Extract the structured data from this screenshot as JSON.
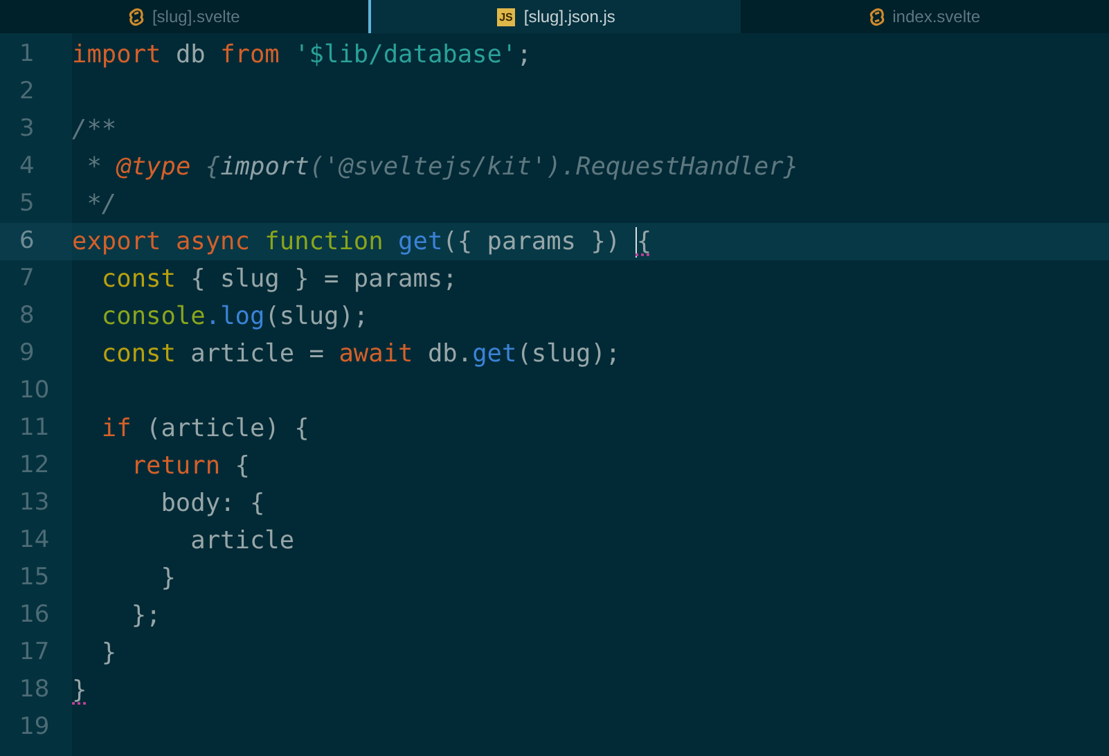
{
  "tabs": [
    {
      "label": "[slug].svelte",
      "kind": "svelte",
      "selected": false
    },
    {
      "label": "[slug].json.js",
      "kind": "js",
      "icon_text": "JS",
      "selected": true
    },
    {
      "label": "index.svelte",
      "kind": "svelte",
      "selected": false
    }
  ],
  "lines": [
    {
      "number": "1",
      "current": false,
      "tokens": [
        {
          "kind": "keyword",
          "text": "import"
        },
        {
          "kind": "plain",
          "text": " db "
        },
        {
          "kind": "keyword",
          "text": "from"
        },
        {
          "kind": "string",
          "text": " '$lib/database'"
        },
        {
          "kind": "plain",
          "text": ";"
        }
      ]
    },
    {
      "number": "2",
      "current": false
    },
    {
      "number": "3",
      "current": false,
      "tokens": [
        {
          "kind": "comment",
          "text": "/**"
        }
      ]
    },
    {
      "number": "4",
      "current": false,
      "tokens": [
        {
          "kind": "comment",
          "text": " * "
        },
        {
          "kind": "doc_tag",
          "text": "@type"
        },
        {
          "kind": "comment",
          "text": " {"
        },
        {
          "kind": "doc_type",
          "text": "import"
        },
        {
          "kind": "comment",
          "text": "('@sveltejs/kit').RequestHandler}"
        }
      ]
    },
    {
      "number": "5",
      "current": false,
      "tokens": [
        {
          "kind": "comment",
          "text": " */"
        }
      ]
    },
    {
      "number": "6",
      "current": true,
      "tokens": [
        {
          "kind": "keyword",
          "text": "export"
        },
        {
          "kind": "keyword",
          "text": " async"
        },
        {
          "kind": "storage",
          "text": " function"
        },
        {
          "kind": "call",
          "text": " get"
        },
        {
          "kind": "plain",
          "text": "({ params }) "
        },
        {
          "kind": "cursor"
        },
        {
          "kind": "plain",
          "text": "{",
          "flagged": true
        }
      ]
    },
    {
      "number": "7",
      "current": false,
      "tokens": [
        {
          "kind": "declare",
          "text": "  const"
        },
        {
          "kind": "plain",
          "text": " { slug } = params;"
        }
      ]
    },
    {
      "number": "8",
      "current": false,
      "tokens": [
        {
          "kind": "storage",
          "text": "  console"
        },
        {
          "kind": "call",
          "text": ".log"
        },
        {
          "kind": "plain",
          "text": "(slug);"
        }
      ]
    },
    {
      "number": "9",
      "current": false,
      "tokens": [
        {
          "kind": "declare",
          "text": "  const"
        },
        {
          "kind": "plain",
          "text": " article = "
        },
        {
          "kind": "keyword",
          "text": "await"
        },
        {
          "kind": "plain",
          "text": " db."
        },
        {
          "kind": "call",
          "text": "get"
        },
        {
          "kind": "plain",
          "text": "(slug);"
        }
      ]
    },
    {
      "number": "10",
      "current": false
    },
    {
      "number": "11",
      "current": false,
      "tokens": [
        {
          "kind": "keyword",
          "text": "  if"
        },
        {
          "kind": "plain",
          "text": " (article) {"
        }
      ]
    },
    {
      "number": "12",
      "current": false,
      "tokens": [
        {
          "kind": "keyword",
          "text": "    return"
        },
        {
          "kind": "plain",
          "text": " {"
        }
      ]
    },
    {
      "number": "13",
      "current": false,
      "tokens": [
        {
          "kind": "plain",
          "text": "      body: {"
        }
      ]
    },
    {
      "number": "14",
      "current": false,
      "tokens": [
        {
          "kind": "plain",
          "text": "        article"
        }
      ]
    },
    {
      "number": "15",
      "current": false,
      "tokens": [
        {
          "kind": "plain",
          "text": "      }"
        }
      ]
    },
    {
      "number": "16",
      "current": false,
      "tokens": [
        {
          "kind": "plain",
          "text": "    };"
        }
      ]
    },
    {
      "number": "17",
      "current": false,
      "tokens": [
        {
          "kind": "plain",
          "text": "  }"
        }
      ]
    },
    {
      "number": "18",
      "current": false,
      "tokens": [
        {
          "kind": "plain",
          "text": "}",
          "flagged": true
        }
      ]
    },
    {
      "number": "19",
      "current": false
    }
  ]
}
